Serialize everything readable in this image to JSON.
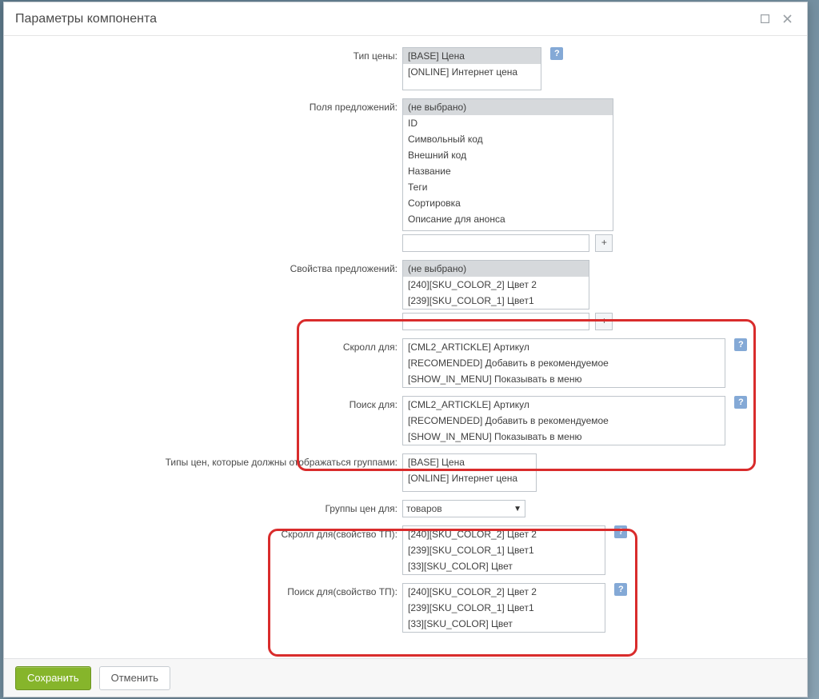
{
  "dialog": {
    "title": "Параметры компонента"
  },
  "fields": {
    "price_type": {
      "label": "Тип цены:",
      "options": [
        "[BASE] Цена",
        "[ONLINE] Интернет цена"
      ],
      "selected_index": 0
    },
    "offer_fields": {
      "label": "Поля предложений:",
      "options": [
        "(не выбрано)",
        "ID",
        "Символьный код",
        "Внешний код",
        "Название",
        "Теги",
        "Сортировка",
        "Описание для анонса"
      ],
      "selected_index": 0
    },
    "offer_props": {
      "label": "Свойства предложений:",
      "options": [
        "(не выбрано)",
        "[240][SKU_COLOR_2] Цвет 2",
        "[239][SKU_COLOR_1] Цвет1"
      ],
      "selected_index": 0
    },
    "scroll_for": {
      "label": "Скролл для:",
      "options": [
        "[CML2_ARTICKLE] Артикул",
        "[RECOMENDED] Добавить в рекомендуемое",
        "[SHOW_IN_MENU] Показывать в меню"
      ]
    },
    "search_for": {
      "label": "Поиск для:",
      "options": [
        "[CML2_ARTICKLE] Артикул",
        "[RECOMENDED] Добавить в рекомендуемое",
        "[SHOW_IN_MENU] Показывать в меню"
      ]
    },
    "price_types_groups": {
      "label": "Типы цен, которые должны отображаться группами:",
      "options": [
        "[BASE] Цена",
        "[ONLINE] Интернет цена"
      ]
    },
    "price_groups_for": {
      "label": "Группы цен для:",
      "value": "товаров"
    },
    "scroll_for_tp": {
      "label": "Скролл для(свойство ТП):",
      "options": [
        "[240][SKU_COLOR_2] Цвет 2",
        "[239][SKU_COLOR_1] Цвет1",
        "[33][SKU_COLOR] Цвет"
      ]
    },
    "search_for_tp": {
      "label": "Поиск для(свойство ТП):",
      "options": [
        "[240][SKU_COLOR_2] Цвет 2",
        "[239][SKU_COLOR_1] Цвет1",
        "[33][SKU_COLOR] Цвет"
      ]
    }
  },
  "buttons": {
    "save": "Сохранить",
    "cancel": "Отменить",
    "plus": "+",
    "help": "?"
  }
}
